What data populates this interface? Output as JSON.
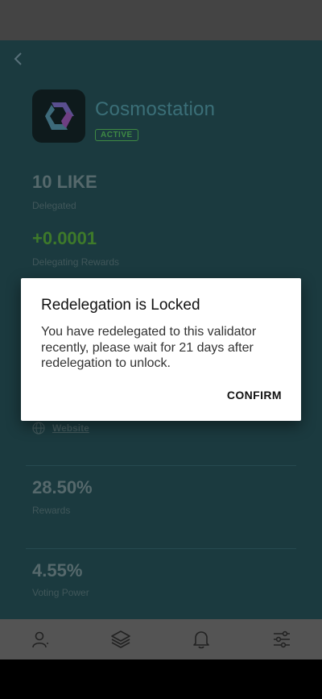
{
  "validator": {
    "name": "Cosmostation",
    "status": "ACTIVE",
    "website_label": "Website"
  },
  "stats": {
    "delegated_amount": "10 LIKE",
    "delegated_label": "Delegated",
    "rewards_amount": "+0.0001",
    "rewards_label": "Delegating Rewards",
    "reward_rate": "28.50%",
    "reward_rate_label": "Rewards",
    "voting_power": "4.55%",
    "voting_power_label": "Voting Power"
  },
  "dialog": {
    "title": "Redelegation is Locked",
    "message": "You have redelegated to this validator recently, please wait for 21 days after redelegation to unlock.",
    "confirm_label": "CONFIRM"
  },
  "bottom_nav": {
    "items": [
      {
        "icon": "wallet-user-icon"
      },
      {
        "icon": "layers-icon"
      },
      {
        "icon": "bell-icon"
      },
      {
        "icon": "settings-sliders-icon"
      }
    ]
  },
  "colors": {
    "screen_bg": "#1b3a3f",
    "accent_name": "#3b6f78",
    "active_badge": "#3f8a44",
    "rewards_green": "#3e7a2a"
  }
}
